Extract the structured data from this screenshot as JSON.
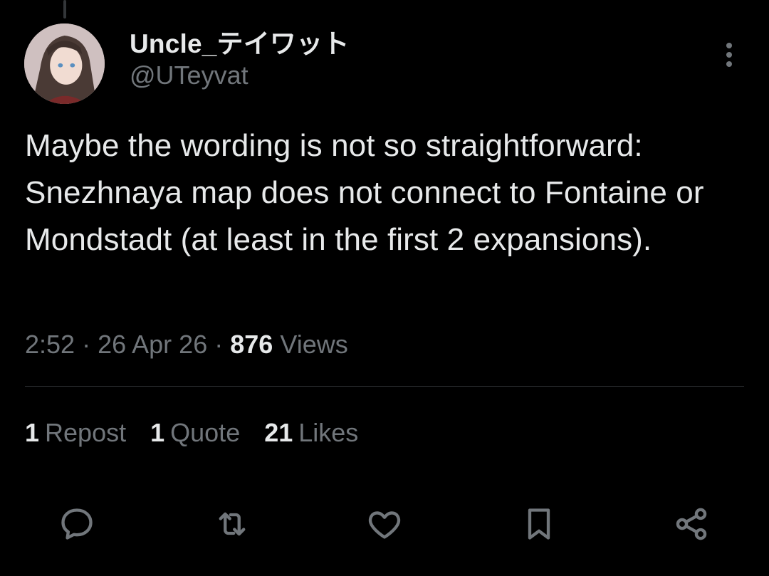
{
  "author": {
    "display_name": "Uncle_テイワット",
    "handle": "@UTeyvat"
  },
  "tweet": {
    "text": "Maybe the wording is not so straightforward: Snezhnaya map does not connect to Fontaine or Mondstadt (at least in the first 2 expansions).",
    "time": "2:52",
    "date": "26 Apr 26",
    "views_count": "876",
    "views_label": "Views"
  },
  "stats": {
    "reposts_count": "1",
    "reposts_label": "Repost",
    "quotes_count": "1",
    "quotes_label": "Quote",
    "likes_count": "21",
    "likes_label": "Likes"
  },
  "icons": {
    "more": "more-vertical-icon",
    "reply": "reply-icon",
    "repost": "repost-icon",
    "like": "heart-icon",
    "bookmark": "bookmark-icon",
    "share": "share-icon"
  },
  "colors": {
    "background": "#000000",
    "text_primary": "#e7e9ea",
    "text_secondary": "#71767b",
    "divider": "#2f3336"
  }
}
